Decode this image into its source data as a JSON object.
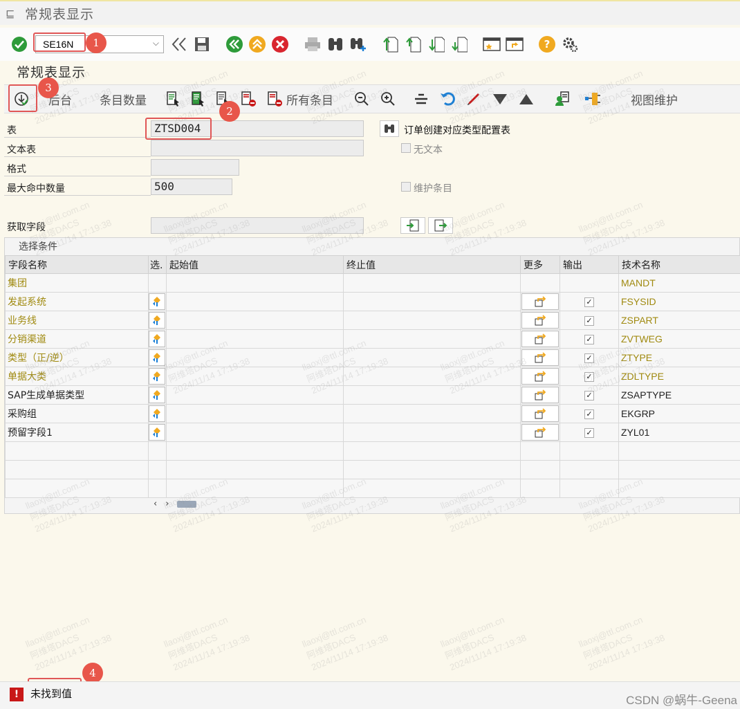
{
  "window": {
    "title": "常规表显示"
  },
  "toolbar": {
    "command_value": "SE16N"
  },
  "screen": {
    "subtitle": "常规表显示"
  },
  "toolbar2": {
    "backend_label": "后台",
    "entry_count_label": "条目数量",
    "all_entries_label": "所有条目",
    "view_maint_label": "视图维护"
  },
  "form": {
    "table_label": "表",
    "table_value": "ZTSD004",
    "table_desc": "订单创建对应类型配置表",
    "text_table_label": "文本表",
    "text_table_value": "",
    "no_text_label": "无文本",
    "layout_label": "格式",
    "layout_value": "",
    "max_hits_label": "最大命中数量",
    "max_hits_value": "500",
    "maintain_entries_label": "维护条目",
    "fetch_fields_label": "获取字段",
    "fetch_fields_value": ""
  },
  "grid": {
    "caption": "选择条件",
    "columns": [
      "字段名称",
      "选.",
      "起始值",
      "终止值",
      "更多",
      "输出",
      "技术名称"
    ],
    "rows": [
      {
        "field": "集团",
        "tech": "MANDT",
        "key": true,
        "has_select": false,
        "has_more": false,
        "output": false
      },
      {
        "field": "发起系统",
        "tech": "FSYSID",
        "key": true,
        "has_select": true,
        "has_more": true,
        "output": true
      },
      {
        "field": "业务线",
        "tech": "ZSPART",
        "key": true,
        "has_select": true,
        "has_more": true,
        "output": true
      },
      {
        "field": "分销渠道",
        "tech": "ZVTWEG",
        "key": true,
        "has_select": true,
        "has_more": true,
        "output": true
      },
      {
        "field": "类型（正/逆）",
        "tech": "ZTYPE",
        "key": true,
        "has_select": true,
        "has_more": true,
        "output": true
      },
      {
        "field": "单据大类",
        "tech": "ZDLTYPE",
        "key": true,
        "has_select": true,
        "has_more": true,
        "output": true
      },
      {
        "field": "SAP生成单据类型",
        "tech": "ZSAPTYPE",
        "key": false,
        "has_select": true,
        "has_more": true,
        "output": true
      },
      {
        "field": "采购组",
        "tech": "EKGRP",
        "key": false,
        "has_select": true,
        "has_more": true,
        "output": true
      },
      {
        "field": "预留字段1",
        "tech": "ZYL01",
        "key": false,
        "has_select": true,
        "has_more": true,
        "output": true
      }
    ],
    "empty_rows": 3
  },
  "status": {
    "message": "未找到值"
  },
  "annotations": [
    "1",
    "2",
    "3",
    "4"
  ],
  "watermark": {
    "line1": "llaoxj@ttl.com.cn",
    "line2": "阿维塔DACS",
    "line3": "2024/11/14 17:19:38"
  },
  "footer": {
    "credit": "CSDN @蜗牛-Geena"
  },
  "colors": {
    "key_field": "#a08a10",
    "annotation": "#e05656",
    "error": "#c81818",
    "ok_green": "#2e9b3a"
  }
}
